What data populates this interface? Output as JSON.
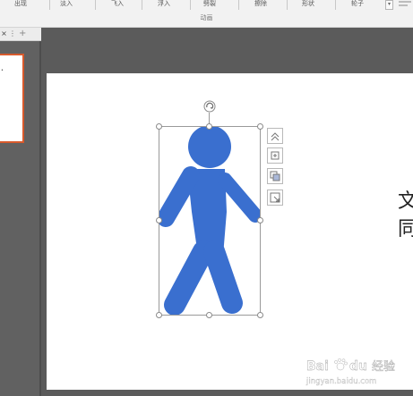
{
  "ribbon": {
    "items": [
      "出现",
      "淡入",
      "飞入",
      "浮入",
      "劈裂",
      "擦除",
      "形状",
      "轮子"
    ],
    "group_label": "动画"
  },
  "tabs": {
    "close": "×",
    "menu": "⋮",
    "add": "+"
  },
  "slide": {
    "text_lines": [
      "文",
      "同"
    ]
  },
  "thumbnail": {
    "text": "•"
  },
  "watermark": {
    "brand": "Bai",
    "brand2": "du",
    "suffix": "经验",
    "url": "jingyan.baidu.com"
  },
  "colors": {
    "figure": "#3a6fcf",
    "thumb_border": "#d85a2c"
  }
}
